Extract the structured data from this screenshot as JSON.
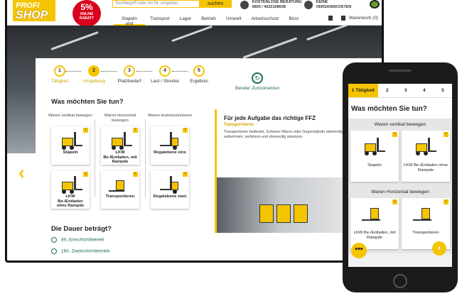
{
  "header": {
    "logo_line1": "PROFI",
    "logo_line2": "SHOP",
    "discount_big": "5%",
    "discount_small": "ONLINE RABATT",
    "search_placeholder": "Suchbegriff oder Art.Nr. eingeben",
    "search_button": "suchen",
    "hotline_title": "KOSTENLOSE BERATUNG",
    "hotline_number": "0800 / 4522108938",
    "shipping_line1": "KEINE",
    "shipping_line2": "VERSANDKOSTEN",
    "nav": [
      {
        "label": "Stapeln und Heben"
      },
      {
        "label": "Transport"
      },
      {
        "label": "Lager"
      },
      {
        "label": "Betrieb"
      },
      {
        "label": "Umwelt"
      },
      {
        "label": "Arbeitsschutz"
      },
      {
        "label": "Büro"
      }
    ],
    "cart_label": "Warenkorb (0)"
  },
  "wizard": {
    "steps": [
      {
        "num": "1",
        "label": "Tätigkeit"
      },
      {
        "num": "2",
        "label": "Umgebung"
      },
      {
        "num": "3",
        "label": "Platzbedarf"
      },
      {
        "num": "4",
        "label": "Last / Strecke"
      },
      {
        "num": "5",
        "label": "Ergebnis"
      }
    ],
    "reset_label": "Berater Zurücksetzen",
    "question": "Was möchten Sie tun?",
    "categories": [
      {
        "head": "Waren vertikal bewegen"
      },
      {
        "head": "Waren Horizontal bewegen"
      },
      {
        "head": "Waren kommissionieren"
      }
    ],
    "cards": [
      {
        "name": "Stapeln"
      },
      {
        "name": "LKW Be-/Entladen, mit Rampde"
      },
      {
        "name": "Regalebene eins"
      },
      {
        "name": "LKW Be-/Entladen ohne Rampde"
      },
      {
        "name": "Transportieren"
      },
      {
        "name": "Regalebene zwei"
      }
    ],
    "card_badge": "i",
    "duration_title": "Die Dauer beträgt?",
    "duration_options": [
      {
        "label": "8h, Einschichtbetrieb"
      },
      {
        "label": "16h, Zweischichtbetrieb"
      }
    ]
  },
  "infobox": {
    "title": "Für jede Aufgabe das richtige FFZ",
    "subtitle": "Transportieren",
    "text": "Transportieren bedeutet, Schwere Waren oder Gegenstände ebenerdig aufnehmen, verfahren und ebenerdig absetzen."
  },
  "mobile": {
    "tabs": [
      {
        "label": "1 Tätigkeit"
      },
      {
        "label": "2"
      },
      {
        "label": "3"
      },
      {
        "label": "4"
      },
      {
        "label": "5"
      }
    ],
    "question": "Was möchten Sie tun?",
    "section1": "Waren vertikal bewegen",
    "cards1": [
      {
        "name": "Stapeln"
      },
      {
        "name": "LKW Be-/Entladen ohne Rampde"
      }
    ],
    "section2": "Waren Horizontal bewegen",
    "cards2": [
      {
        "name": "LKW Be-/Entladen, mit Rampde"
      },
      {
        "name": "Transportieren"
      }
    ],
    "fab": "•••",
    "next": "›"
  },
  "colors": {
    "accent": "#f5c400",
    "green": "#1f6e4c",
    "red": "#d9001b"
  }
}
